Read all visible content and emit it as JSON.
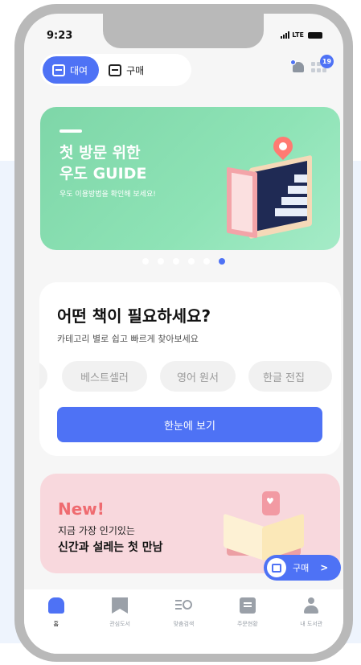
{
  "status_bar": {
    "time": "9:23",
    "network": "LTE"
  },
  "mode_toggle": {
    "rent_label": "대여",
    "buy_label": "구매"
  },
  "notifications": {
    "badge_count": "19"
  },
  "guide_banner": {
    "line1": "첫 방문 위한",
    "line2": "우도 GUIDE",
    "subtitle": "우도 이용방법을 확인해 보세요!"
  },
  "carousel": {
    "count": 6,
    "active_index": 5
  },
  "category_card": {
    "title": "어떤 책이 필요하세요?",
    "subtitle": "카테고리 별로 쉽고 빠르게 찾아보세요",
    "chips": [
      "베스트셀러",
      "영어 원서",
      "한글 전집"
    ],
    "button_label": "한눈에 보기"
  },
  "new_banner": {
    "label": "New!",
    "line1": "지금 가장 인기있는",
    "line2": "신간과 설레는 첫 만남"
  },
  "buy_float": {
    "label": "구매",
    "chevron": ">"
  },
  "tabbar": {
    "items": [
      {
        "label": "홈",
        "icon": "home-icon"
      },
      {
        "label": "관심도서",
        "icon": "bookmark-icon"
      },
      {
        "label": "맞춤검색",
        "icon": "list-search-icon"
      },
      {
        "label": "주문현황",
        "icon": "order-icon"
      },
      {
        "label": "내 도서관",
        "icon": "user-icon"
      }
    ]
  },
  "colors": {
    "primary": "#4e72f5",
    "guide_green": "#8ee3b6",
    "new_pink": "#f8d8dd",
    "new_label": "#ef6b70"
  }
}
